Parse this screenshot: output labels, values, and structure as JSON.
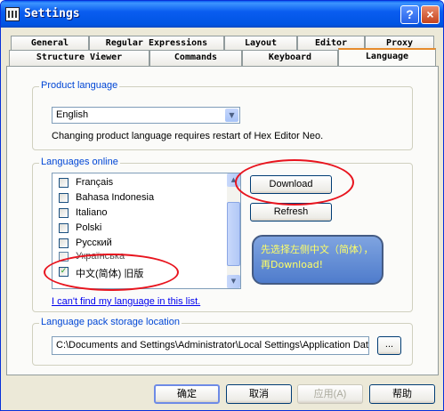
{
  "window": {
    "title": "Settings",
    "help_label": "?",
    "close_label": "×"
  },
  "tabs": {
    "row1": [
      "General",
      "Regular Expressions",
      "Layout",
      "Editor",
      "Proxy"
    ],
    "row2": [
      "Structure Viewer",
      "Commands",
      "Keyboard",
      "Language"
    ],
    "active": "Language"
  },
  "product_language": {
    "legend": "Product language",
    "selected": "English",
    "note": "Changing product language requires restart of Hex Editor Neo."
  },
  "languages_online": {
    "legend": "Languages online",
    "items": [
      {
        "label": "Français",
        "checked": false
      },
      {
        "label": "Bahasa Indonesia",
        "checked": false
      },
      {
        "label": "Italiano",
        "checked": false
      },
      {
        "label": "Polski",
        "checked": false
      },
      {
        "label": "Русский",
        "checked": false
      },
      {
        "label": "Українська",
        "checked": false
      },
      {
        "label": "中文(简体) 旧版",
        "checked": true
      }
    ],
    "download_label": "Download",
    "refresh_label": "Refresh",
    "missing_link": "I can't find my language in this list."
  },
  "annotation": {
    "text": "先选择左侧中文（简体），再Download!",
    "color": "#e8141e"
  },
  "storage": {
    "legend": "Language pack storage location",
    "path": "C:\\Documents and Settings\\Administrator\\Local Settings\\Application Data",
    "browse_label": "..."
  },
  "footer": {
    "ok": "确定",
    "cancel": "取消",
    "apply": "应用(A)",
    "help": "帮助"
  }
}
